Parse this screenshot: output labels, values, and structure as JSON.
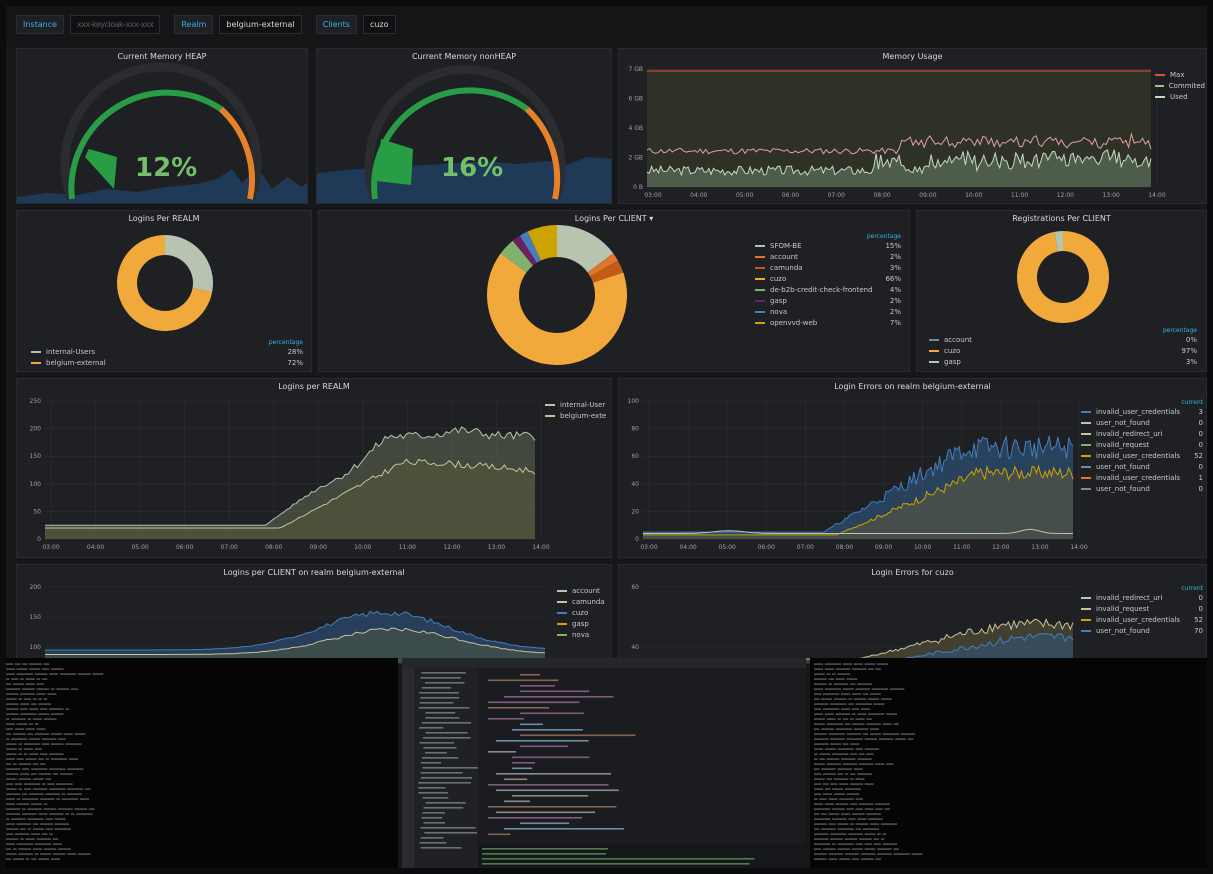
{
  "topbar": {
    "instance_label": "Instance",
    "instance_value": "xxx-keycloak-xxx-xxx",
    "realm_label": "Realm",
    "realm_value": "belgium-external",
    "clients_label": "Clients",
    "clients_value": "cuzo"
  },
  "panels": {
    "heap": {
      "title": "Current Memory HEAP",
      "value": "12%"
    },
    "nonheap": {
      "title": "Current Memory nonHEAP",
      "value": "16%"
    },
    "memory": {
      "title": "Memory Usage",
      "legend": [
        {
          "name": "Max",
          "color": "#e24d42"
        },
        {
          "name": "Commited",
          "color": "#9ac48a"
        },
        {
          "name": "Used",
          "color": "#c8d8c0"
        }
      ]
    },
    "logins_realm_pie": {
      "title": "Logins Per REALM",
      "header": "percentage",
      "legend": [
        {
          "name": "internal-Users",
          "value": "28%",
          "color": "#b7c4b0"
        },
        {
          "name": "belgium-external",
          "value": "72%",
          "color": "#f2a93b"
        }
      ]
    },
    "logins_client_pie": {
      "title": "Logins Per CLIENT",
      "header": "percentage",
      "legend": [
        {
          "name": "SFOM-BE",
          "value": "15%",
          "color": "#b7c4b0"
        },
        {
          "name": "account",
          "value": "2%",
          "color": "#e0752d"
        },
        {
          "name": "camunda",
          "value": "3%",
          "color": "#c15c17"
        },
        {
          "name": "cuzo",
          "value": "66%",
          "color": "#f2a93b"
        },
        {
          "name": "de-b2b-credit-check-frontend",
          "value": "4%",
          "color": "#7eb26d"
        },
        {
          "name": "gasp",
          "value": "2%",
          "color": "#6d1f62"
        },
        {
          "name": "nova",
          "value": "2%",
          "color": "#447ebc"
        },
        {
          "name": "openvvd-web",
          "value": "7%",
          "color": "#cca300"
        }
      ]
    },
    "registrations_pie": {
      "title": "Registrations Per CLIENT",
      "header": "percentage",
      "legend": [
        {
          "name": "account",
          "value": "0%",
          "color": "#6d8d9e"
        },
        {
          "name": "cuzo",
          "value": "97%",
          "color": "#f2a93b"
        },
        {
          "name": "gasp",
          "value": "3%",
          "color": "#b7c4b0"
        }
      ]
    },
    "logins_per_realm": {
      "title": "Logins per REALM",
      "legend": [
        {
          "name": "internal-User",
          "color": "#b7c4b0"
        },
        {
          "name": "belgium-exte",
          "color": "#c8c29a"
        }
      ]
    },
    "login_errors_realm": {
      "title": "Login Errors on realm belgium-external",
      "header": "current",
      "legend": [
        {
          "name": "invalid_user_credentials",
          "value": "3",
          "color": "#447ebc"
        },
        {
          "name": "user_not_found",
          "value": "0",
          "color": "#b7c4b0"
        },
        {
          "name": "invalid_redirect_uri",
          "value": "0",
          "color": "#c8c29a"
        },
        {
          "name": "invalid_request",
          "value": "0",
          "color": "#7eb26d"
        },
        {
          "name": "invalid_user_credentials",
          "value": "52",
          "color": "#cca300"
        },
        {
          "name": "user_not_found",
          "value": "0",
          "color": "#6d8d9e"
        },
        {
          "name": "invalid_user_credentials",
          "value": "1",
          "color": "#e0752d"
        },
        {
          "name": "user_not_found",
          "value": "0",
          "color": "#8a8a8a"
        }
      ]
    },
    "logins_per_client_realm": {
      "title": "Logins per CLIENT on realm belgium-external",
      "legend": [
        {
          "name": "account",
          "color": "#b7c4b0"
        },
        {
          "name": "camunda",
          "color": "#c8c29a"
        },
        {
          "name": "cuzo",
          "color": "#447ebc"
        },
        {
          "name": "gasp",
          "color": "#cca300"
        },
        {
          "name": "nova",
          "color": "#7eb26d"
        }
      ]
    },
    "login_errors_cuzo": {
      "title": "Login Errors for cuzo",
      "header": "current",
      "legend": [
        {
          "name": "invalid_redirect_uri",
          "value": "0",
          "color": "#b7c4b0"
        },
        {
          "name": "invalid_request",
          "value": "0",
          "color": "#c8c29a"
        },
        {
          "name": "invalid_user_credentials",
          "value": "52",
          "color": "#cca300"
        },
        {
          "name": "user_not_found",
          "value": "70",
          "color": "#447ebc"
        }
      ]
    }
  },
  "memory_axis": {
    "y_ticks": [
      "7 GB",
      "6 GB",
      "4 GB",
      "2 GB",
      "0 B"
    ],
    "x_ticks": [
      "03:00",
      "04:00",
      "05:00",
      "06:00",
      "07:00",
      "08:00",
      "09:00",
      "10:00",
      "11:00",
      "12:00",
      "13:00",
      "14:00"
    ]
  },
  "realm_axis": {
    "y_ticks": [
      "250",
      "200",
      "150",
      "100",
      "50",
      "0"
    ],
    "x_ticks": [
      "03:00",
      "04:00",
      "05:00",
      "06:00",
      "07:00",
      "08:00",
      "09:00",
      "10:00",
      "11:00",
      "12:00",
      "13:00",
      "14:00"
    ]
  },
  "errors_axis": {
    "y_ticks": [
      "100",
      "80",
      "60",
      "40",
      "20",
      "0"
    ],
    "x_ticks": [
      "03:00",
      "04:00",
      "05:00",
      "06:00",
      "07:00",
      "08:00",
      "09:00",
      "10:00",
      "11:00",
      "12:00",
      "13:00",
      "14:00"
    ]
  },
  "client_axis": {
    "y_ticks": [
      "200",
      "150",
      "100"
    ]
  },
  "cuzo_axis": {
    "y_ticks": [
      "60",
      "40"
    ]
  }
}
